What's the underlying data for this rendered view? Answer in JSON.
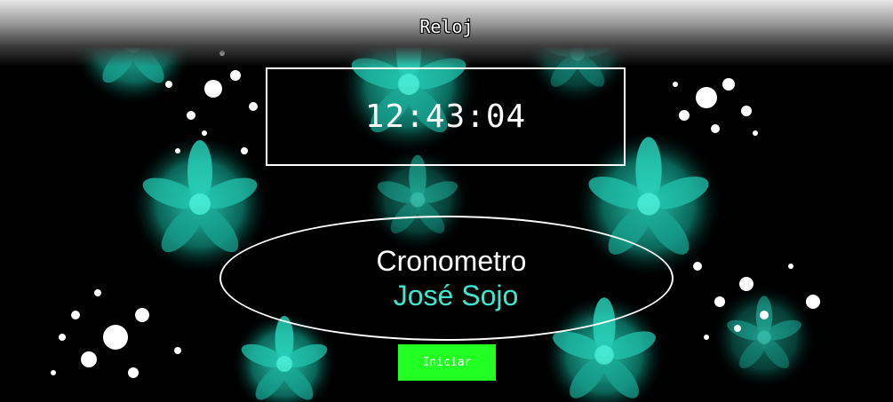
{
  "header": {
    "title": "Reloj"
  },
  "clock": {
    "time": "12:43:04"
  },
  "stopwatch": {
    "label": "Cronometro",
    "author": "José Sojo"
  },
  "controls": {
    "start_label": "Iniciar"
  },
  "theme": {
    "accent": "#3ee6cf",
    "button": "#22ff22",
    "background": "#000000"
  }
}
